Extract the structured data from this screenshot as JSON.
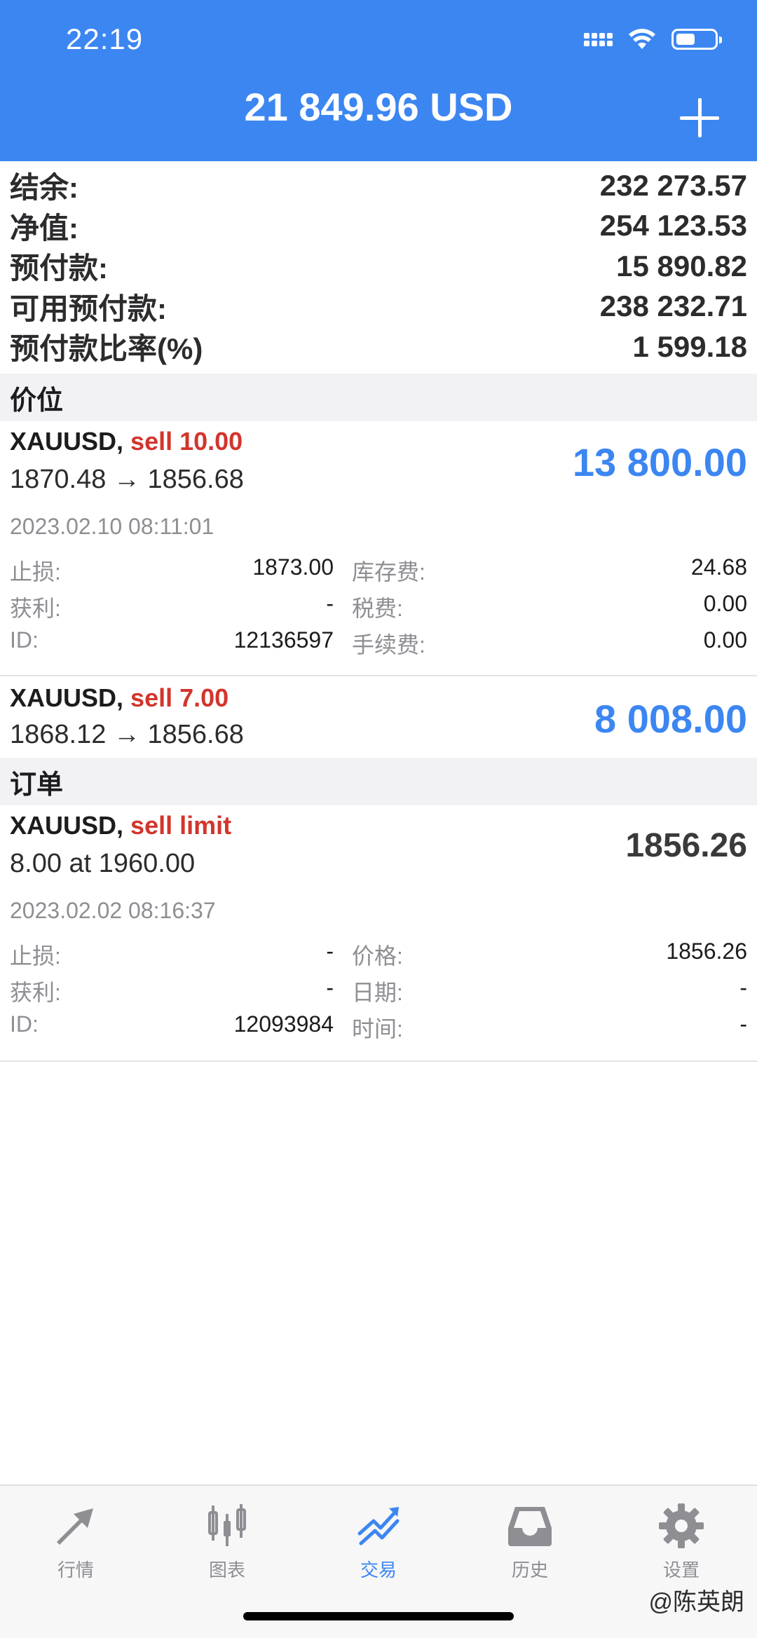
{
  "status_bar": {
    "time": "22:19"
  },
  "header": {
    "balance_title": "21 849.96 USD"
  },
  "summary": [
    {
      "label": "结余:",
      "value": "232 273.57"
    },
    {
      "label": "净值:",
      "value": "254 123.53"
    },
    {
      "label": "预付款:",
      "value": "15 890.82"
    },
    {
      "label": "可用预付款:",
      "value": "238 232.71"
    },
    {
      "label": "预付款比率(%)",
      "value": "1 599.18"
    }
  ],
  "positions_section": "价位",
  "positions": [
    {
      "symbol": "XAUUSD,",
      "side": "sell 10.00",
      "prices": "1870.48 → 1856.68",
      "profit": "13 800.00",
      "time": "2023.02.10 08:11:01",
      "details": {
        "sl_label": "止损:",
        "sl": "1873.00",
        "swap_label": "库存费:",
        "swap": "24.68",
        "tp_label": "获利:",
        "tp": "-",
        "tax_label": "税费:",
        "tax": "0.00",
        "id_label": "ID:",
        "id": "12136597",
        "fee_label": "手续费:",
        "fee": "0.00"
      }
    },
    {
      "symbol": "XAUUSD,",
      "side": "sell 7.00",
      "prices": "1868.12 → 1856.68",
      "profit": "8 008.00"
    }
  ],
  "orders_section": "订单",
  "order": {
    "symbol": "XAUUSD,",
    "side": "sell limit",
    "desc": "8.00 at 1960.00",
    "price": "1856.26",
    "time": "2023.02.02 08:16:37",
    "details": {
      "sl_label": "止损:",
      "sl": "-",
      "price_label": "价格:",
      "price": "1856.26",
      "tp_label": "获利:",
      "tp": "-",
      "date_label": "日期:",
      "date": "-",
      "id_label": "ID:",
      "id": "12093984",
      "time_label": "时间:",
      "time": "-"
    }
  },
  "tabs": [
    {
      "label": "行情",
      "icon": "quotes-icon"
    },
    {
      "label": "图表",
      "icon": "chart-icon"
    },
    {
      "label": "交易",
      "icon": "trade-icon",
      "active": true
    },
    {
      "label": "历史",
      "icon": "history-icon"
    },
    {
      "label": "设置",
      "icon": "settings-icon"
    }
  ],
  "watermark": "@陈英朗",
  "colors": {
    "accent": "#3c86f2",
    "sell": "#d2352d",
    "header": "#3c86f2"
  }
}
